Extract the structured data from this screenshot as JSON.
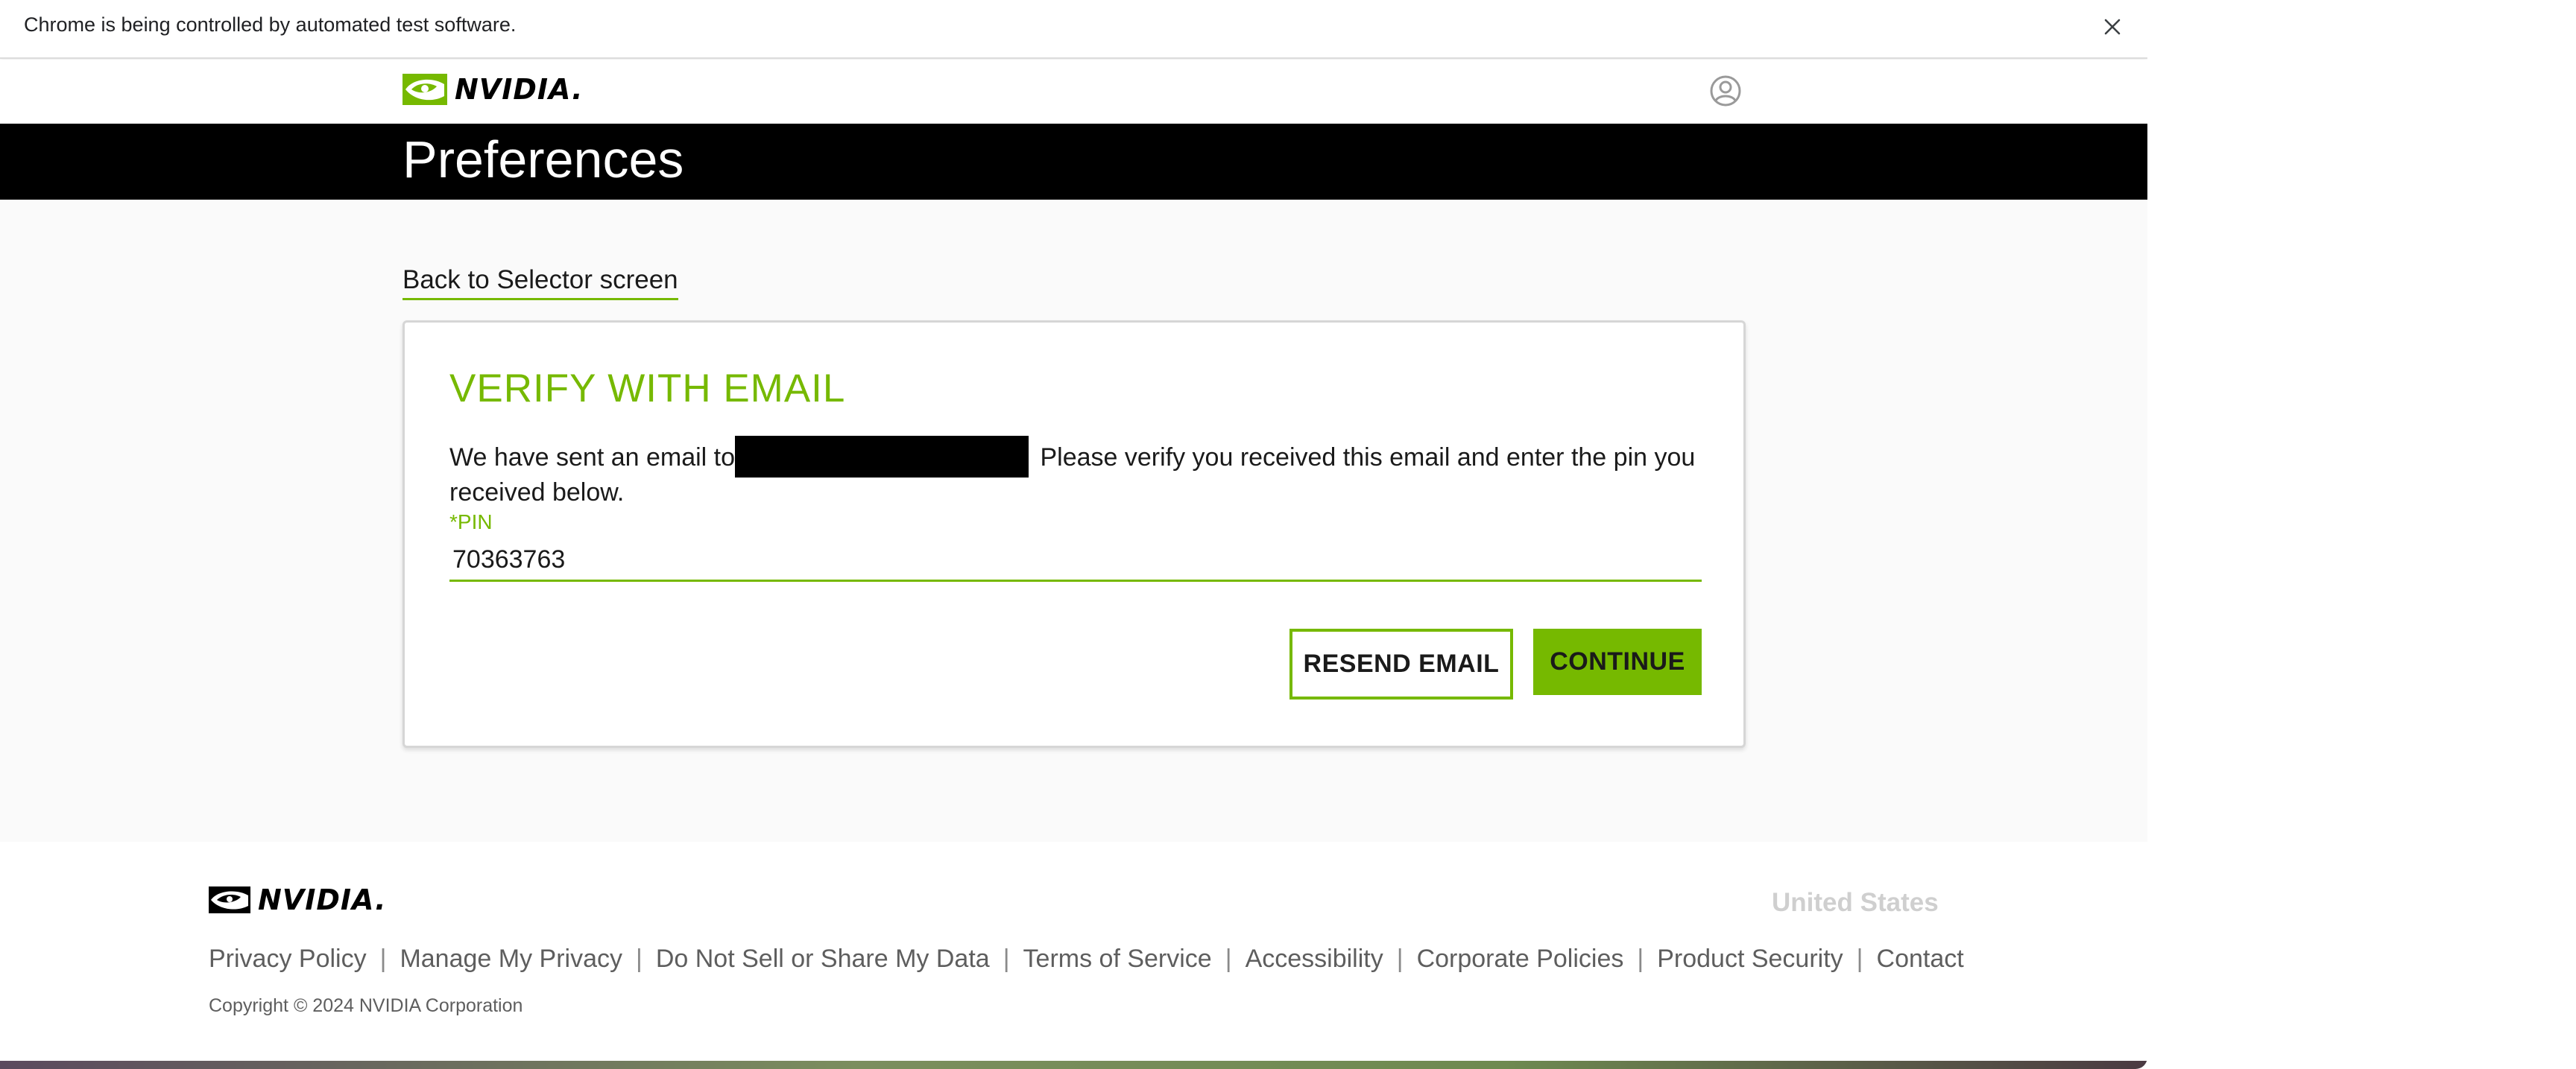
{
  "infobar": {
    "message": "Chrome is being controlled by automated test software.",
    "close_icon": "close-icon"
  },
  "nav": {
    "logo_text": "NVIDIA.",
    "account_icon": "user-circle-icon"
  },
  "header": {
    "title": "Preferences"
  },
  "main": {
    "back_link": "Back to Selector screen",
    "card": {
      "title": "VERIFY WITH EMAIL",
      "desc_before": "We have sent an email to",
      "desc_after": " Please verify you received this email and enter the pin you received below.",
      "pin_label": "*PIN",
      "pin_value": "70363763",
      "resend_label": "RESEND EMAIL",
      "continue_label": "CONTINUE"
    }
  },
  "footer": {
    "logo_text": "NVIDIA.",
    "region": "United States",
    "links": [
      "Privacy Policy",
      "Manage My Privacy",
      "Do Not Sell or Share My Data",
      "Terms of Service",
      "Accessibility",
      "Corporate Policies",
      "Product Security",
      "Contact"
    ],
    "separator": "|",
    "copyright": "Copyright © 2024 NVIDIA Corporation"
  },
  "colors": {
    "accent": "#76b900",
    "header_bg": "#000000",
    "text": "#1a1a1a",
    "footer_text": "#5e5e5e"
  }
}
